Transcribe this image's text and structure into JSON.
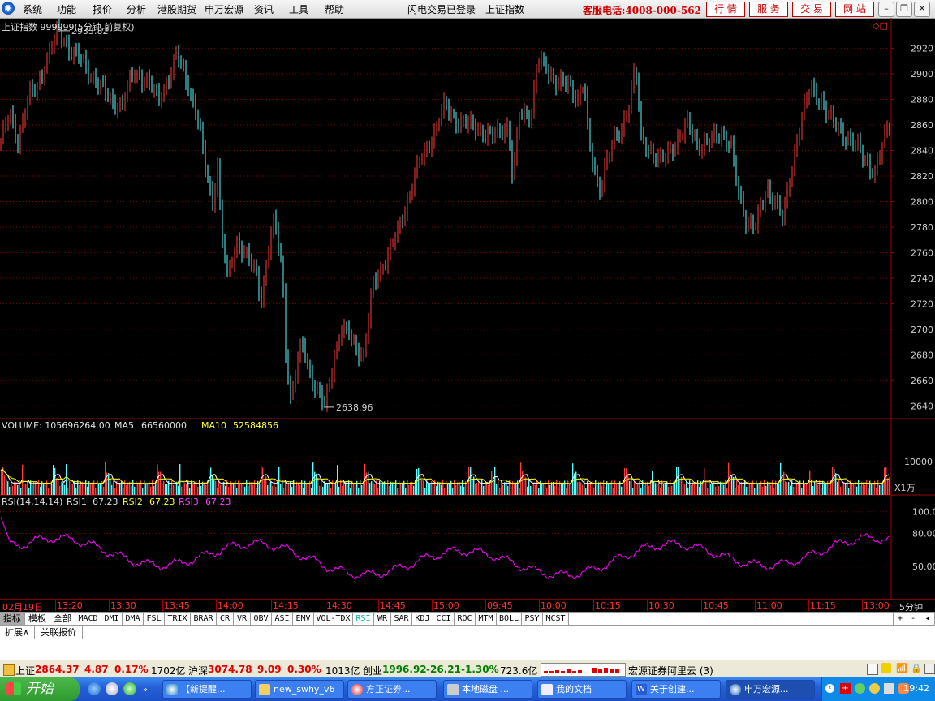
{
  "menubar": {
    "items": [
      "系统",
      "功能",
      "报价",
      "分析",
      "港股期货",
      "申万宏源",
      "资讯",
      "工具",
      "帮助"
    ],
    "login_status": "闪电交易已登录",
    "current_symbol": "上证指数",
    "hotline": "客服电话:4008-000-562",
    "quick_buttons": [
      "行 情",
      "服 务",
      "交 易",
      "网 站"
    ]
  },
  "chart_data": [
    {
      "type": "line",
      "title": "上证指数 999999(5分钟,前复权)",
      "ylim": [
        2630,
        2935
      ],
      "y_ticks": [
        2640,
        2660,
        2680,
        2700,
        2720,
        2740,
        2760,
        2780,
        2800,
        2820,
        2840,
        2860,
        2880,
        2900,
        2920
      ],
      "annotations": [
        {
          "label": "2933.82",
          "y": 2933.82
        },
        {
          "label": "2638.96",
          "y": 2638.96
        }
      ],
      "up_color": "#ff3c3c",
      "down_color": "#54ffff",
      "anchors": [
        [
          0,
          2846
        ],
        [
          12,
          2868
        ],
        [
          22,
          2848
        ],
        [
          35,
          2882
        ],
        [
          45,
          2888
        ],
        [
          55,
          2908
        ],
        [
          72,
          2933.82
        ],
        [
          88,
          2918
        ],
        [
          100,
          2910
        ],
        [
          118,
          2895
        ],
        [
          135,
          2880
        ],
        [
          150,
          2875
        ],
        [
          165,
          2902
        ],
        [
          180,
          2895
        ],
        [
          195,
          2880
        ],
        [
          210,
          2900
        ],
        [
          218,
          2915
        ],
        [
          232,
          2892
        ],
        [
          245,
          2860
        ],
        [
          252,
          2830
        ],
        [
          262,
          2800
        ],
        [
          268,
          2830
        ],
        [
          272,
          2780
        ],
        [
          280,
          2740
        ],
        [
          292,
          2770
        ],
        [
          305,
          2755
        ],
        [
          315,
          2745
        ],
        [
          322,
          2725
        ],
        [
          330,
          2760
        ],
        [
          338,
          2785
        ],
        [
          348,
          2745
        ],
        [
          352,
          2685
        ],
        [
          358,
          2645
        ],
        [
          372,
          2690
        ],
        [
          385,
          2660
        ],
        [
          392,
          2650
        ],
        [
          400,
          2638.96
        ],
        [
          412,
          2680
        ],
        [
          420,
          2700
        ],
        [
          430,
          2695
        ],
        [
          440,
          2685
        ],
        [
          448,
          2680
        ],
        [
          460,
          2735
        ],
        [
          475,
          2755
        ],
        [
          490,
          2775
        ],
        [
          505,
          2808
        ],
        [
          515,
          2828
        ],
        [
          525,
          2840
        ],
        [
          535,
          2855
        ],
        [
          548,
          2875
        ],
        [
          560,
          2865
        ],
        [
          575,
          2860
        ],
        [
          590,
          2858
        ],
        [
          605,
          2850
        ],
        [
          618,
          2857
        ],
        [
          626,
          2860
        ],
        [
          632,
          2815
        ],
        [
          640,
          2868
        ],
        [
          655,
          2870
        ],
        [
          662,
          2910
        ],
        [
          672,
          2905
        ],
        [
          685,
          2895
        ],
        [
          700,
          2890
        ],
        [
          712,
          2882
        ],
        [
          720,
          2895
        ],
        [
          725,
          2845
        ],
        [
          738,
          2808
        ],
        [
          745,
          2828
        ],
        [
          755,
          2845
        ],
        [
          765,
          2855
        ],
        [
          775,
          2878
        ],
        [
          783,
          2905
        ],
        [
          790,
          2848
        ],
        [
          800,
          2842
        ],
        [
          815,
          2830
        ],
        [
          830,
          2845
        ],
        [
          848,
          2860
        ],
        [
          860,
          2845
        ],
        [
          872,
          2845
        ],
        [
          888,
          2855
        ],
        [
          900,
          2845
        ],
        [
          910,
          2805
        ],
        [
          920,
          2785
        ],
        [
          932,
          2782
        ],
        [
          945,
          2810
        ],
        [
          955,
          2802
        ],
        [
          965,
          2785
        ],
        [
          975,
          2825
        ],
        [
          985,
          2860
        ],
        [
          998,
          2888
        ],
        [
          1012,
          2880
        ],
        [
          1025,
          2862
        ],
        [
          1040,
          2853
        ],
        [
          1055,
          2843
        ],
        [
          1068,
          2832
        ],
        [
          1078,
          2822
        ],
        [
          1088,
          2845
        ],
        [
          1095,
          2862
        ]
      ]
    },
    {
      "type": "bar",
      "title": "VOLUME: 105696264.00",
      "series": [
        {
          "name": "VOLUME",
          "value": 105696264.0
        },
        {
          "name": "MA5",
          "value": 66560000.0
        },
        {
          "name": "MA10",
          "value": 52584856.0
        }
      ],
      "y_ticks": [
        10000
      ],
      "unit": "X1万",
      "colors": {
        "MA5": "#ffffff",
        "MA10": "#ffff00"
      }
    },
    {
      "type": "line",
      "title": "RSI(14,14,14)",
      "series": [
        {
          "name": "RSI1",
          "value": 67.23
        },
        {
          "name": "RSI2",
          "value": 67.23
        },
        {
          "name": "RSI3",
          "value": 67.23
        }
      ],
      "y_ticks": [
        50.0,
        80.0,
        100.0
      ],
      "colors": {
        "RSI1": "#ffffff",
        "RSI2": "#ffff00",
        "RSI3": "#ff00ff"
      }
    }
  ],
  "chart_extras": {
    "corner_icons": "◇□",
    "x_labels": [
      "02月19日",
      "13:20",
      "13:30",
      "13:45",
      "14:00",
      "14:15",
      "14:30",
      "14:45",
      "15:00",
      "09:45",
      "10:00",
      "10:15",
      "10:30",
      "10:45",
      "11:00",
      "11:15",
      "13:00"
    ],
    "period": "5分钟",
    "zoom_buttons": [
      "+",
      "-"
    ]
  },
  "tabs": [
    "指标",
    "模板",
    "全部",
    "MACD",
    "DMI",
    "DMA",
    "FSL",
    "TRIX",
    "BRAR",
    "CR",
    "VR",
    "OBV",
    "ASI",
    "EMV",
    "VOL-TDX",
    "RSI",
    "WR",
    "SAR",
    "KDJ",
    "CCI",
    "ROC",
    "MTM",
    "BOLL",
    "PSY",
    "MCST"
  ],
  "extra_tabs": [
    "扩展∧",
    "关联报价"
  ],
  "status": {
    "sh_label": "上证",
    "sh_value": "2864.37",
    "sh_change": "4.87",
    "sh_pct": "0.17%",
    "sh_amount": "1702亿",
    "hs_label": "沪深",
    "hs_value": "3074.78",
    "hs_change": "9.09",
    "hs_pct": "0.30%",
    "hs_amount": "1013亿",
    "cy_label": "创业",
    "cy_value": "1996.92",
    "cy_change": "-26.21",
    "cy_pct": "-1.30%",
    "cy_amount": "723.6亿",
    "broker": "宏源证券阿里云 (3)"
  },
  "taskbar": {
    "start": "开始",
    "tasks": [
      "【新提醒...",
      "new_swhy_v6",
      "方正证券...",
      "本地磁盘 ...",
      "我的文档",
      "关于创建...",
      "申万宏源..."
    ],
    "clock": "19:42"
  }
}
